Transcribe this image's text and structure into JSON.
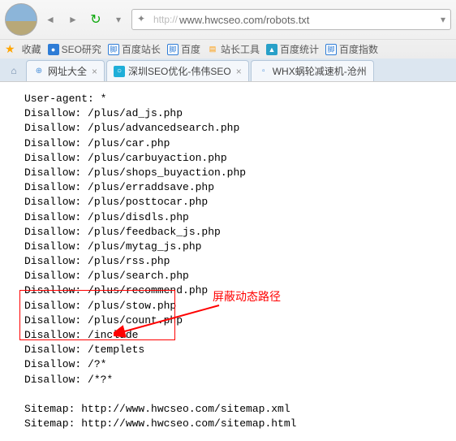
{
  "url": {
    "prefix": "http://",
    "address": "www.hwcseo.com/robots.txt"
  },
  "bookmarks": {
    "favorites_label": "收藏",
    "items": [
      {
        "label": "SEO研究"
      },
      {
        "label": "百度站长"
      },
      {
        "label": "百度"
      },
      {
        "label": "站长工具"
      },
      {
        "label": "百度统计"
      },
      {
        "label": "百度指数"
      }
    ]
  },
  "tabs": [
    {
      "title": "网址大全"
    },
    {
      "title": "深圳SEO优化-伟伟SEO"
    },
    {
      "title": "WHX蜗轮减速机-沧州"
    }
  ],
  "robots": {
    "lines": [
      "User-agent: *",
      "Disallow: /plus/ad_js.php",
      "Disallow: /plus/advancedsearch.php",
      "Disallow: /plus/car.php",
      "Disallow: /plus/carbuyaction.php",
      "Disallow: /plus/shops_buyaction.php",
      "Disallow: /plus/erraddsave.php",
      "Disallow: /plus/posttocar.php",
      "Disallow: /plus/disdls.php",
      "Disallow: /plus/feedback_js.php",
      "Disallow: /plus/mytag_js.php",
      "Disallow: /plus/rss.php",
      "Disallow: /plus/search.php",
      "Disallow: /plus/recommend.php",
      "Disallow: /plus/stow.php",
      "Disallow: /plus/count.php",
      "Disallow: /include",
      "Disallow: /templets",
      "Disallow: /?*",
      "Disallow: /*?*",
      "",
      "Sitemap: http://www.hwcseo.com/sitemap.xml",
      "Sitemap: http://www.hwcseo.com/sitemap.html"
    ]
  },
  "annotation": {
    "text": "屏蔽动态路径"
  }
}
